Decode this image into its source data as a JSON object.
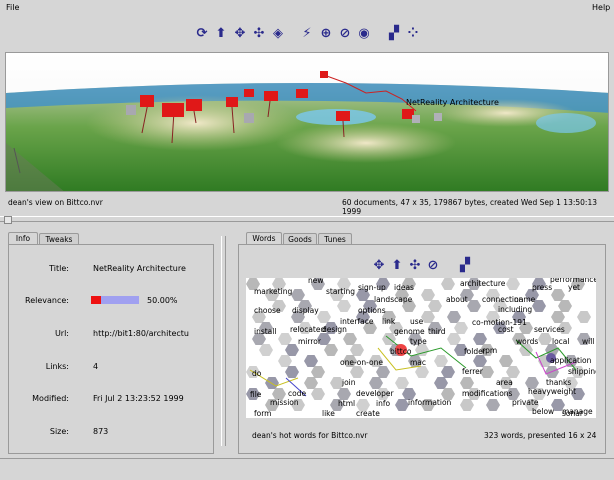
{
  "menu": {
    "file": "File",
    "help": "Help"
  },
  "toolbar_top": {
    "icons": [
      "rotate-icon",
      "up-arrow-icon",
      "move-icon",
      "expand-icon",
      "target-icon",
      "link-icon",
      "crosshair-icon",
      "no-link-icon",
      "eye-icon",
      "cube-icon",
      "scatter-icon"
    ]
  },
  "scene": {
    "label": "NetReality Architecture",
    "view_caption": "dean's view on Bittco.nvr",
    "stats": "60 documents, 47 x 35, 179867 bytes, created Wed Sep  1 13:50:13 1999"
  },
  "left_panel": {
    "tabs": [
      "Info",
      "Tweaks"
    ],
    "active_tab": "Info",
    "fields": [
      {
        "label": "Title:",
        "value": "NetReality Architecture"
      },
      {
        "label": "Relevance:",
        "value": "50.00%"
      },
      {
        "label": "Url:",
        "value": "http://bit1:80/architectu"
      },
      {
        "label": "Links:",
        "value": "4"
      },
      {
        "label": "Modified:",
        "value": "Fri Jul  2 13:23:52 1999"
      },
      {
        "label": "Size:",
        "value": "873"
      }
    ],
    "relevance_fraction": 0.5,
    "colors": {
      "relevance_high": "#ee1111",
      "relevance_low": "#a0a0f0"
    }
  },
  "right_panel": {
    "tabs": [
      "Words",
      "Goods",
      "Tunes"
    ],
    "active_tab": "Words",
    "toolbar_icons": [
      "move-icon",
      "up-arrow-icon",
      "expand-icon",
      "no-link-icon",
      "cube-icon"
    ],
    "words": [
      "new",
      "marketing",
      "starting",
      "sign-up",
      "ideas",
      "architecture",
      "press",
      "yet",
      "performance",
      "choose",
      "display",
      "landscape",
      "about",
      "connection",
      "name",
      "options",
      "including",
      "install",
      "relocated",
      "interface",
      "link",
      "use",
      "co-motion-191",
      "design",
      "genome",
      "third",
      "cost",
      "services",
      "mirror",
      "type",
      "words",
      "local",
      "will",
      "bittco",
      "folder",
      "rpm",
      "one-on-one",
      "mac",
      "application",
      "ferrer",
      "shipping",
      "do",
      "join",
      "area",
      "thanks",
      "developer",
      "modifications",
      "heavyweight",
      "file",
      "code",
      "mission",
      "info",
      "information",
      "private",
      "form",
      "html",
      "like",
      "create",
      "below",
      "sonar",
      "manage"
    ],
    "caption": "dean's hot words for Bittco.nvr",
    "stats": "323 words, presented 16 x 24"
  }
}
